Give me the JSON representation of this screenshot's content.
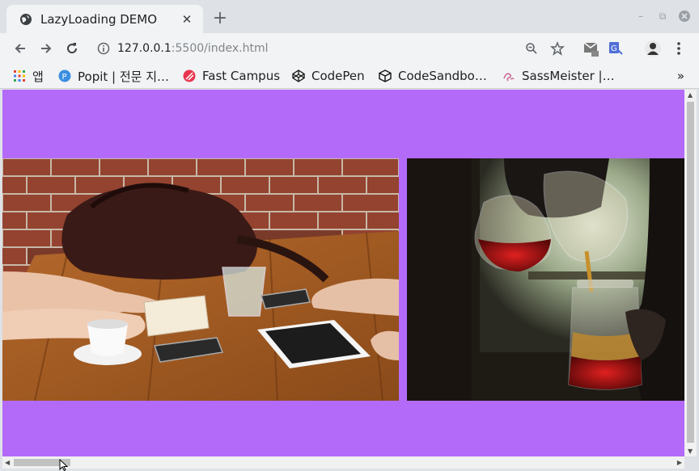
{
  "tab": {
    "title": "LazyLoading DEMO",
    "close": "✕"
  },
  "toolbar": {
    "url_host": "127.0.0.1",
    "url_path": ":5500/index.html"
  },
  "bookmarks": [
    {
      "label": "앱",
      "icon": "apps-grid-icon"
    },
    {
      "label": "Popit | 전문 지…",
      "icon": "popit-icon"
    },
    {
      "label": "Fast Campus",
      "icon": "fastcampus-icon"
    },
    {
      "label": "CodePen",
      "icon": "codepen-icon"
    },
    {
      "label": "CodeSandbo…",
      "icon": "codesandbox-icon"
    },
    {
      "label": "SassMeister |…",
      "icon": "sassmeister-icon"
    }
  ],
  "bookmarks_more": "»",
  "page": {
    "background": "#b36af9",
    "images": [
      {
        "subject": "people-at-wooden-table-with-devices"
      },
      {
        "subject": "pouring-tea-into-mason-jar"
      }
    ]
  }
}
